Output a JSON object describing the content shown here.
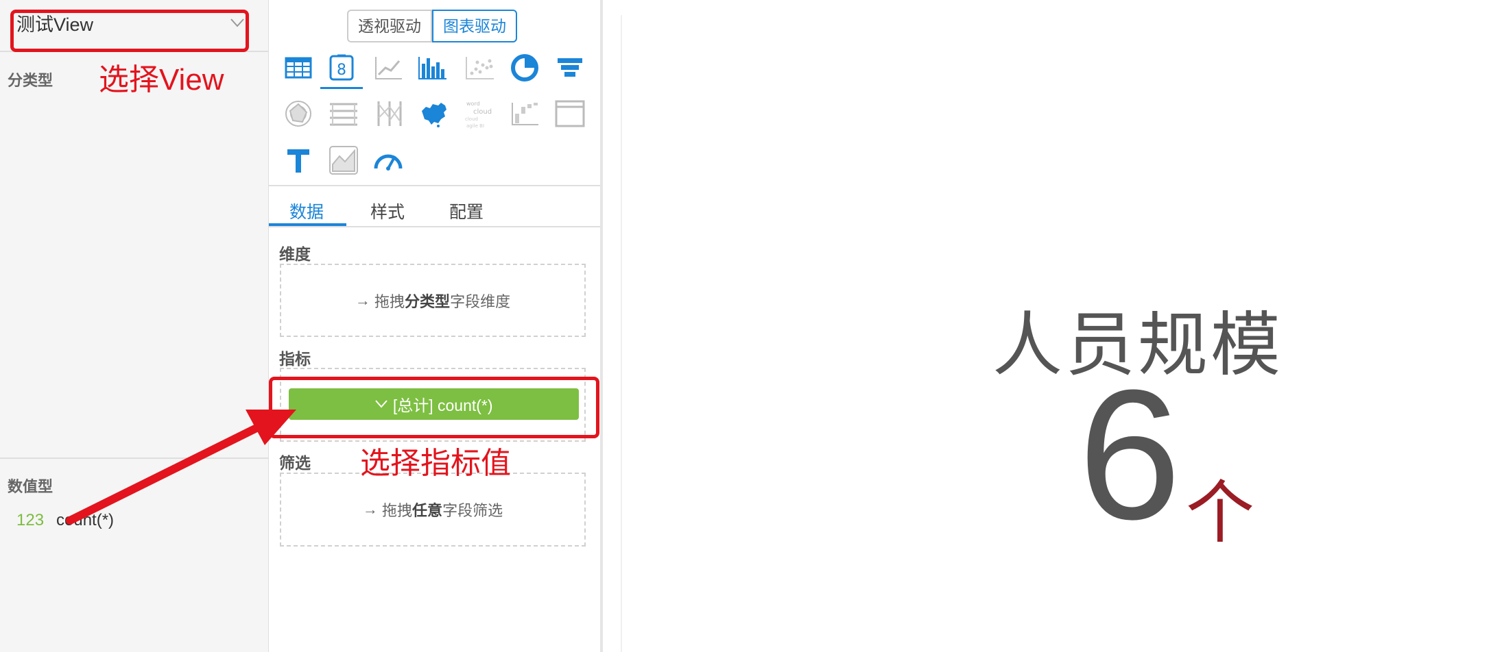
{
  "left_panel": {
    "view_name": "测试View",
    "section_category": "分类型",
    "section_numeric": "数值型",
    "numeric_fields": [
      {
        "type_badge": "123",
        "name": "count(*)"
      }
    ]
  },
  "config_panel": {
    "mode_toggle": [
      "透视驱动",
      "图表驱动"
    ],
    "active_mode": "图表驱动",
    "chart_types": [
      "table-chart-icon",
      "scorecard-chart-icon",
      "line-chart-icon",
      "bar-chart-icon",
      "scatter-chart-icon",
      "pie-chart-icon",
      "funnel-chart-icon",
      "radar-chart-icon",
      "parallel-chart-icon",
      "sankey-chart-icon",
      "china-map-icon",
      "word-cloud-icon",
      "waterfall-chart-icon",
      "iframe-chart-icon",
      "text-chart-icon",
      "area-chart-icon",
      "gauge-chart-icon"
    ],
    "selected_chart": "scorecard-chart-icon",
    "word_cloud_icon_text": [
      "word",
      "cloud",
      "cloud",
      "agile BI"
    ],
    "tabs": [
      "数据",
      "样式",
      "配置"
    ],
    "active_tab": "数据",
    "dimension_label": "维度",
    "dimension_hint": {
      "arrow": "→",
      "prefix": "拖拽",
      "emph": "分类型",
      "suffix": "字段维度"
    },
    "metric_label": "指标",
    "metric_item": "[总计] count(*)",
    "filter_label": "筛选",
    "filter_hint": {
      "arrow": "→",
      "prefix": "拖拽",
      "emph": "任意",
      "suffix": "字段筛选"
    }
  },
  "canvas": {
    "kpi_title": "人员规模",
    "kpi_value": "6",
    "kpi_unit": "个"
  },
  "annotations": {
    "select_view": "选择View",
    "select_metric": "选择指标值"
  },
  "colors": {
    "accent_blue": "#1b85d8",
    "metric_green": "#7dbf42",
    "annotation_red": "#e3141d",
    "unit_red": "#9b1c24"
  }
}
